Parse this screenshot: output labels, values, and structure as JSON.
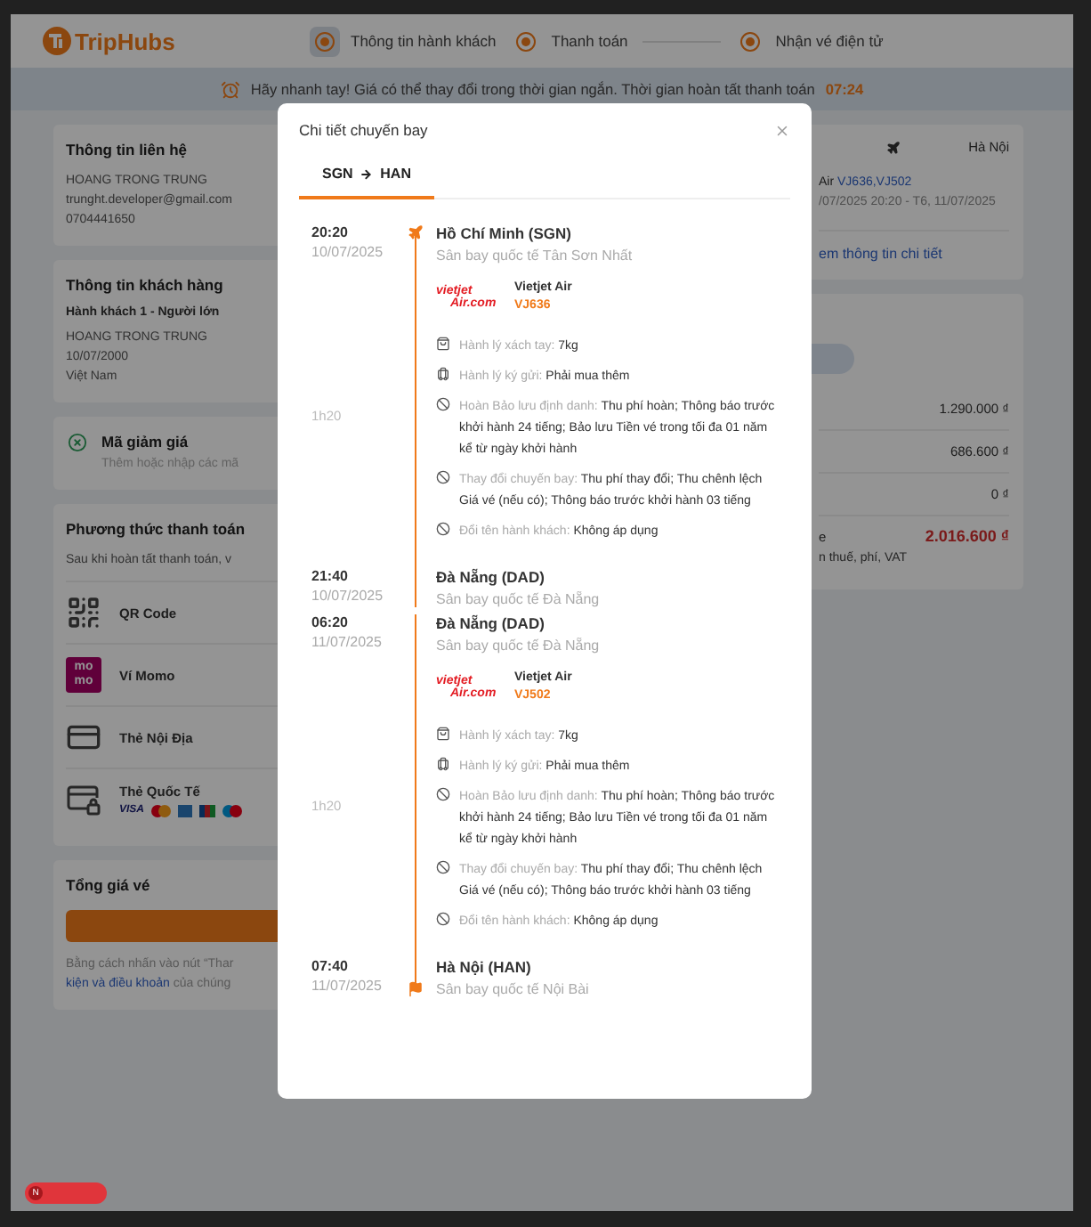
{
  "header": {
    "brand": "TripHubs",
    "steps": [
      {
        "label": "Thông tin hành khách",
        "selected": true
      },
      {
        "label": "Thanh toán",
        "selected": false
      },
      {
        "label": "Nhận vé điện tử",
        "selected": false
      }
    ]
  },
  "banner": {
    "message": "Hãy nhanh tay! Giá có thể thay đổi trong thời gian ngắn. Thời gian hoàn tất thanh toán",
    "countdown": "07:24"
  },
  "contact": {
    "title": "Thông tin liên hệ",
    "lines": [
      "HOANG TRONG TRUNG",
      "trunght.developer@gmail.com",
      "0704441650"
    ]
  },
  "passengers": {
    "title": "Thông tin khách hàng",
    "items": [
      {
        "heading": "Hành khách 1 - Người lớn",
        "lines": [
          "HOANG TRONG TRUNG",
          "10/07/2000",
          "Việt Nam"
        ]
      }
    ]
  },
  "discount": {
    "title": "Mã giảm giá",
    "hint": "Thêm hoặc nhập các mã"
  },
  "payment": {
    "title": "Phương thức thanh toán",
    "note": "Sau khi hoàn tất thanh toán, v",
    "methods": [
      {
        "kind": "qr",
        "label": "QR Code"
      },
      {
        "kind": "momo",
        "label": "Ví Momo",
        "logo": [
          "mo",
          "mo"
        ]
      },
      {
        "kind": "domestic",
        "label": "Thẻ Nội Địa"
      },
      {
        "kind": "international",
        "label": "Thẻ Quốc Tế",
        "brand_text": "VISA"
      }
    ]
  },
  "total": {
    "title": "Tổng giá vé",
    "terms": "Bằng cách nhấn vào nút “Thar",
    "link": "kiện và điều khoản",
    "after": " của chúng"
  },
  "trip": {
    "to": "Hà Nội",
    "airline": "Air",
    "flights": "VJ636,VJ502",
    "schedule": "/07/2025 20:20 - T6, 11/07/2025",
    "link": "em thông tin chi tiết"
  },
  "prices": {
    "rows": [
      {
        "value": "1.290.000 ₫"
      },
      {
        "value": "686.600 ₫"
      },
      {
        "value": "0 ₫"
      }
    ],
    "total_label": "e",
    "total": "2.016.600 ₫",
    "note": "n thuế, phí, VAT"
  },
  "dev_badge": {
    "initial": "N"
  },
  "flight_detail": {
    "title": "Chi tiết chuyến bay",
    "tabs": [
      {
        "from": "SGN",
        "to": "HAN",
        "selected": true
      }
    ],
    "legs": [
      {
        "depart": {
          "time": "20:20",
          "date": "10/07/2025",
          "city": "Hồ Chí Minh (SGN)",
          "airport": "Sân bay quốc tế Tân Sơn Nhất"
        },
        "duration": "1h20",
        "logo": [
          "vietjet",
          "Air.com"
        ],
        "airline": "Vietjet Air",
        "flight_no": "VJ636",
        "rules": [
          {
            "kind": "carry_on",
            "label": "Hành lý xách tay:",
            "value": "7kg"
          },
          {
            "kind": "checked_bag",
            "label": "Hành lý ký gửi:",
            "value": "Phải mua thêm"
          },
          {
            "kind": "policy",
            "label": "Hoàn Bảo lưu định danh:",
            "value": "Thu phí hoàn; Thông báo trước khởi hành 24 tiếng; Bảo lưu Tiền vé trong tối đa 01 năm kể từ ngày khởi hành"
          },
          {
            "kind": "policy",
            "label": "Thay đổi chuyến bay:",
            "value": "Thu phí thay đổi; Thu chênh lệch Giá vé (nếu có); Thông báo trước khởi hành 03 tiếng"
          },
          {
            "kind": "policy",
            "label": "Đổi tên hành khách:",
            "value": "Không áp dụng"
          }
        ],
        "arrive": {
          "time": "21:40",
          "date": "10/07/2025",
          "city": "Đà Nẵng (DAD)",
          "airport": "Sân bay quốc tế Đà Nẵng"
        }
      },
      {
        "depart": {
          "time": "06:20",
          "date": "11/07/2025",
          "city": "Đà Nẵng (DAD)",
          "airport": "Sân bay quốc tế Đà Nẵng"
        },
        "duration": "1h20",
        "logo": [
          "vietjet",
          "Air.com"
        ],
        "airline": "Vietjet Air",
        "flight_no": "VJ502",
        "rules": [
          {
            "kind": "carry_on",
            "label": "Hành lý xách tay:",
            "value": "7kg"
          },
          {
            "kind": "checked_bag",
            "label": "Hành lý ký gửi:",
            "value": "Phải mua thêm"
          },
          {
            "kind": "policy",
            "label": "Hoàn Bảo lưu định danh:",
            "value": "Thu phí hoàn; Thông báo trước khởi hành 24 tiếng; Bảo lưu Tiền vé trong tối đa 01 năm kể từ ngày khởi hành"
          },
          {
            "kind": "policy",
            "label": "Thay đổi chuyến bay:",
            "value": "Thu phí thay đổi; Thu chênh lệch Giá vé (nếu có); Thông báo trước khởi hành 03 tiếng"
          },
          {
            "kind": "policy",
            "label": "Đổi tên hành khách:",
            "value": "Không áp dụng"
          }
        ],
        "arrive": {
          "time": "07:40",
          "date": "11/07/2025",
          "city": "Hà Nội (HAN)",
          "airport": "Sân bay quốc tế Nội Bài"
        }
      }
    ]
  }
}
